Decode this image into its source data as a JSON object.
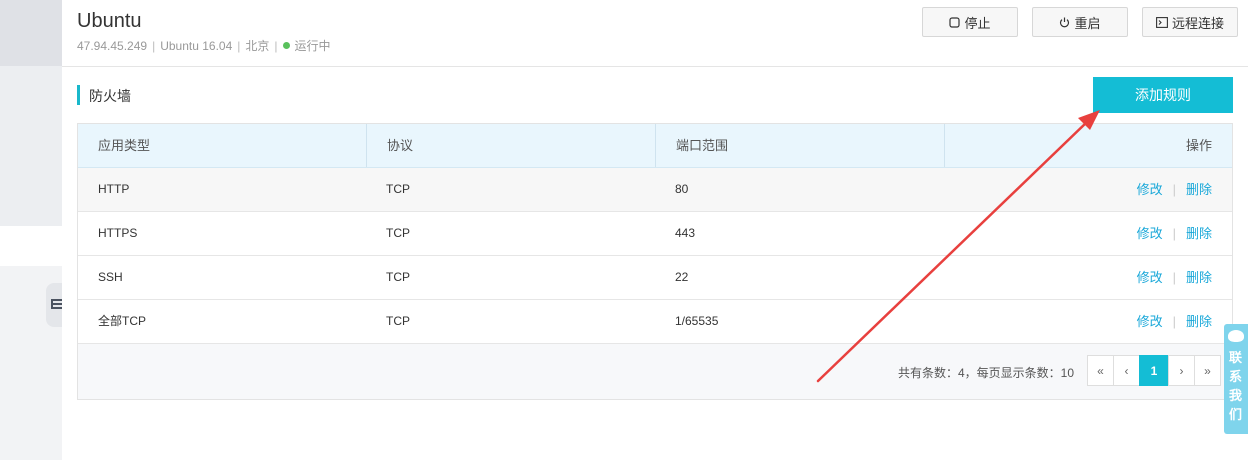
{
  "instance": {
    "name": "Ubuntu",
    "ip": "47.94.45.249",
    "os": "Ubuntu 16.04",
    "region": "北京",
    "status": "运行中",
    "sep": "|"
  },
  "header_buttons": {
    "stop": "停止",
    "restart": "重启",
    "remote": "远程连接"
  },
  "section": {
    "title": "防火墙",
    "add_rule": "添加规则"
  },
  "table": {
    "headers": [
      "应用类型",
      "协议",
      "端口范围",
      "操作"
    ],
    "rows": [
      {
        "app": "HTTP",
        "protocol": "TCP",
        "port": "80"
      },
      {
        "app": "HTTPS",
        "protocol": "TCP",
        "port": "443"
      },
      {
        "app": "SSH",
        "protocol": "TCP",
        "port": "22"
      },
      {
        "app": "全部TCP",
        "protocol": "TCP",
        "port": "1/65535"
      }
    ],
    "ops": {
      "edit": "修改",
      "delete": "删除",
      "sep": "|"
    }
  },
  "pagination": {
    "summary": "共有条数：4，每页显示条数：10",
    "first": "«",
    "prev": "‹",
    "current": "1",
    "next": "›",
    "last": "»"
  },
  "contact": {
    "label": "联系我们",
    "icon": "chat-icon"
  },
  "colors": {
    "accent": "#14bdd5",
    "link": "#1aa8d9",
    "status_ok": "#59c15c",
    "arrow": "#e8403e"
  }
}
